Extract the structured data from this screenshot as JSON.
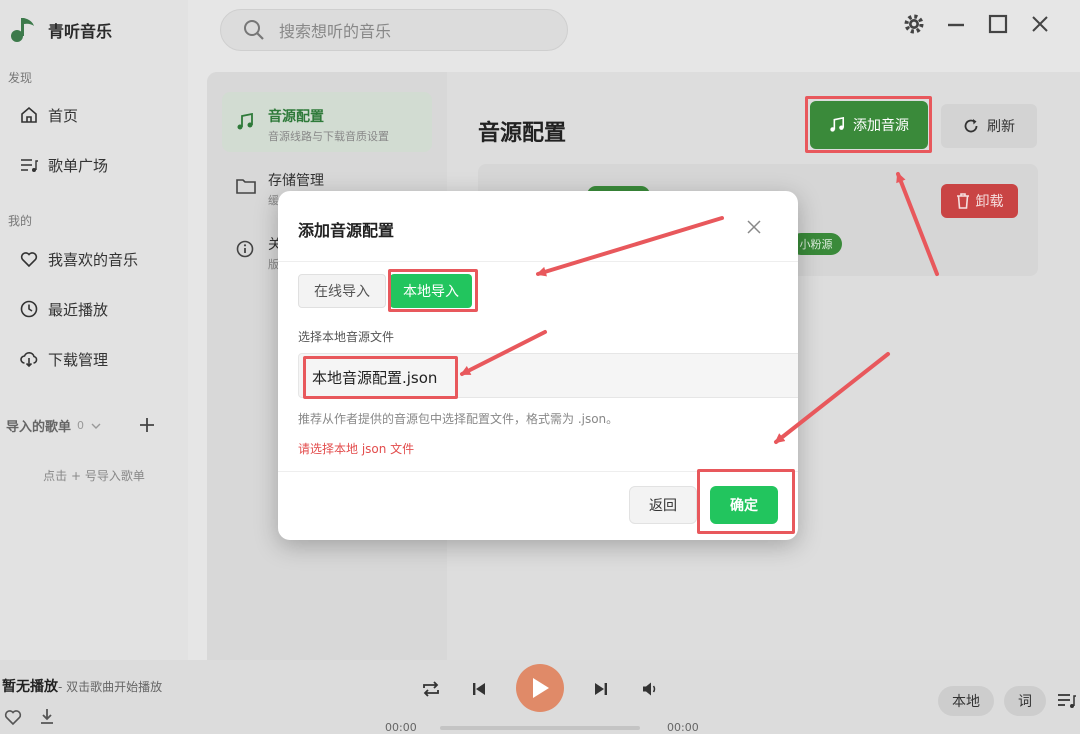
{
  "app": {
    "name": "青听音乐",
    "search_placeholder": "搜索想听的音乐",
    "accent": "#22c55e"
  },
  "sidebar": {
    "discover_label": "发现",
    "discover_items": [
      {
        "label": "首页",
        "icon": "home-icon"
      },
      {
        "label": "歌单广场",
        "icon": "playlist-icon"
      }
    ],
    "mine_label": "我的",
    "mine_items": [
      {
        "label": "我喜欢的音乐",
        "icon": "heart-icon"
      },
      {
        "label": "最近播放",
        "icon": "clock-icon"
      },
      {
        "label": "下载管理",
        "icon": "cloud-download-icon"
      }
    ],
    "imported_label": "导入的歌单",
    "imported_count": "0",
    "imported_hint": "点击 + 号导入歌单"
  },
  "settings_nav": [
    {
      "title": "音源配置",
      "subtitle": "音源线路与下载音质设置",
      "icon": "music-note-icon",
      "active": true
    },
    {
      "title": "存储管理",
      "subtitle": "缓",
      "icon": "folder-icon",
      "active": false
    },
    {
      "title": "关",
      "subtitle": "版",
      "icon": "info-icon",
      "active": false
    }
  ],
  "content": {
    "title": "音源配置",
    "add_button": "添加音源",
    "refresh_button": "刷新",
    "uninstall_button": "卸载",
    "source_tag": "小粉源"
  },
  "dialog": {
    "title": "添加音源配置",
    "tabs": [
      "在线导入",
      "本地导入"
    ],
    "active_tab": 1,
    "field_label": "选择本地音源文件",
    "file_value": "本地音源配置.json",
    "hint": "推荐从作者提供的音源包中选择配置文件，格式需为 .json。",
    "error": "请选择本地 json 文件",
    "back_button": "返回",
    "confirm_button": "确定"
  },
  "player": {
    "status": "暂无播放",
    "status_hint": " - 双击歌曲开始播放",
    "time_current": "00:00",
    "time_total": "00:00",
    "local_button": "本地",
    "lyrics_button": "词"
  }
}
